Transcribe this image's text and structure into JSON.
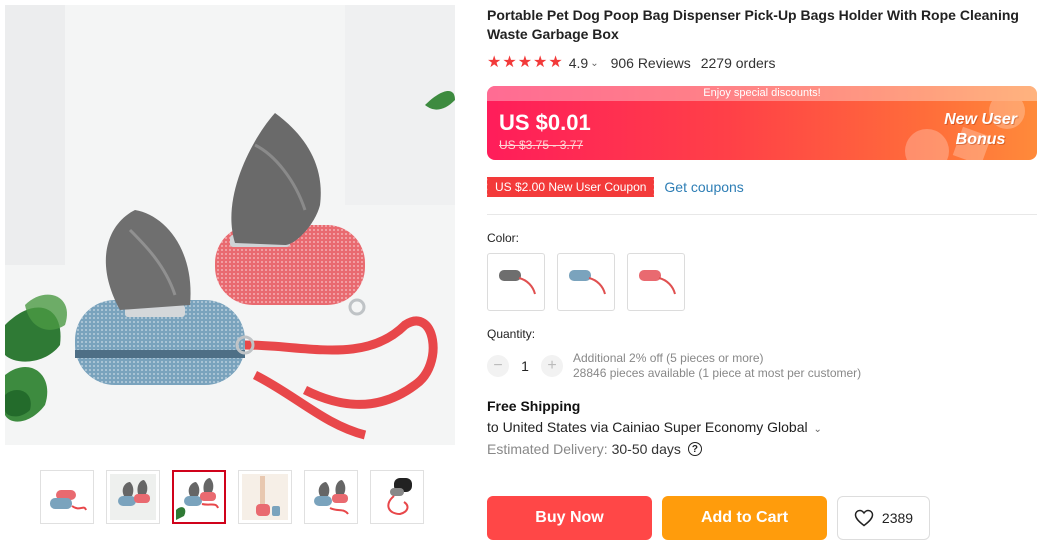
{
  "product": {
    "title": "Portable Pet Dog Poop Bag Dispenser Pick-Up Bags Holder With Rope Cleaning Waste Garbage Box",
    "rating": "4.9",
    "reviews": "906 Reviews",
    "orders": "2279 orders",
    "stars": 5
  },
  "price": {
    "banner": "Enjoy special discounts!",
    "current": "US $0.01",
    "original": "US $3.75 - 3.77",
    "bonus_line1": "New User",
    "bonus_line2": "Bonus"
  },
  "coupon": {
    "badge": "US $2.00 New User Coupon",
    "link": "Get coupons"
  },
  "color": {
    "label": "Color:",
    "options": [
      "gray",
      "blue",
      "pink"
    ]
  },
  "quantity": {
    "label": "Quantity:",
    "minus": "−",
    "plus": "+",
    "value": "1",
    "note_line1": "Additional 2% off (5 pieces or more)",
    "note_line2": "28846 pieces available (1 piece at most per customer)"
  },
  "shipping": {
    "title": "Free Shipping",
    "destination": "to United States via Cainiao Super Economy Global",
    "delivery_label": "Estimated Delivery:",
    "delivery_days": "30-50 days",
    "help_glyph": "?"
  },
  "actions": {
    "buy": "Buy Now",
    "cart": "Add to Cart",
    "wishlist_count": "2389"
  },
  "icons": {
    "star": "star-icon",
    "chevron": "chevron-down-icon",
    "help": "help-circle-icon",
    "heart": "heart-outline-icon"
  },
  "colors": {
    "accent_red": "#ff4747",
    "cart_orange": "#ff9c0c",
    "star_red": "#f23a3a",
    "link_blue": "#2e7eb5"
  }
}
